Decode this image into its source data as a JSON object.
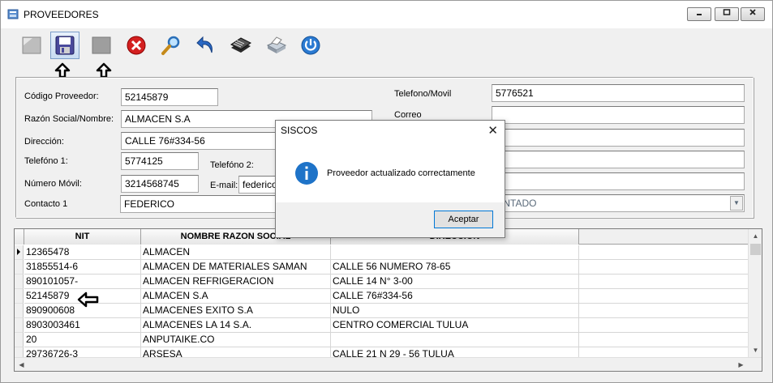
{
  "window": {
    "title": "PROVEEDORES"
  },
  "colors": {
    "accent": "#0078d7",
    "info_icon": "#1e73c8"
  },
  "toolbar": {
    "buttons": [
      {
        "name": "new-icon"
      },
      {
        "name": "save-icon"
      },
      {
        "name": "edit-icon"
      },
      {
        "name": "delete-icon"
      },
      {
        "name": "search-icon"
      },
      {
        "name": "undo-icon"
      },
      {
        "name": "list-icon"
      },
      {
        "name": "print-icon"
      },
      {
        "name": "exit-icon"
      }
    ]
  },
  "form": {
    "codigo_label": "Código Proveedor:",
    "codigo_value": "52145879",
    "razon_label": "Razón Social/Nombre:",
    "razon_value": "ALMACEN S.A",
    "direccion_label": "Dirección:",
    "direccion_value": "CALLE 76#334-56",
    "telefono1_label": "Telefóno 1:",
    "telefono1_value": "5774125",
    "telefono2_label": "Telefóno 2:",
    "movil_label": "Número Móvil:",
    "movil_value": "3214568745",
    "email_label": "E-mail:",
    "email_value": "federico",
    "contacto_label": "Contacto 1",
    "contacto_value": "FEDERICO",
    "telmovil_label": "Telefono/Movil",
    "telmovil_value": "5776521",
    "correo_label": "Correo",
    "forma_pago_value": "ONTADO"
  },
  "grid": {
    "columns": [
      "NIT",
      "NOMBRE RAZON SOCIAL",
      "DIRECCION"
    ],
    "rows": [
      [
        "12365478",
        "ALMACEN",
        ""
      ],
      [
        "31855514-6",
        "ALMACEN DE MATERIALES SAMAN",
        "CALLE 56 NUMERO 78-65"
      ],
      [
        "890101057-",
        "ALMACEN REFRIGERACION",
        "CALLE 14 N° 3-00"
      ],
      [
        "52145879",
        "ALMACEN S.A",
        "CALLE 76#334-56"
      ],
      [
        "890900608",
        "ALMACENES EXITO S.A",
        "NULO"
      ],
      [
        "8903003461",
        "ALMACENES LA 14 S.A.",
        "CENTRO COMERCIAL TULUA"
      ],
      [
        "20",
        "ANPUTAIKE.CO",
        ""
      ],
      [
        "29736726-3",
        "ARSESA",
        "CALLE 21 N 29 - 56 TULUA"
      ]
    ]
  },
  "dialog": {
    "title": "SISCOS",
    "message": "Proveedor actualizado correctamente",
    "ok_label": "Aceptar"
  }
}
